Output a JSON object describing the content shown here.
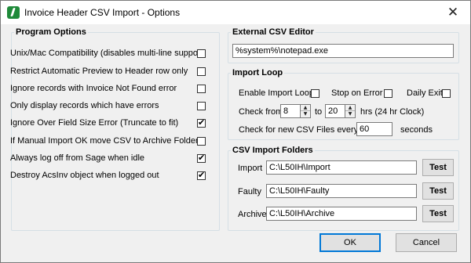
{
  "window": {
    "title": "Invoice Header CSV Import - Options",
    "close_symbol": "✕"
  },
  "program_options": {
    "legend": "Program Options",
    "items": [
      {
        "label": "Unix/Mac Compatibility (disables multi-line support)",
        "checked": false
      },
      {
        "label": "Restrict Automatic Preview to Header row only",
        "checked": false
      },
      {
        "label": "Ignore records with Invoice Not Found error",
        "checked": false
      },
      {
        "label": "Only display records which have errors",
        "checked": false
      },
      {
        "label": "Ignore Over Field Size Error (Truncate to fit)",
        "checked": true
      },
      {
        "label": "If Manual Import OK move CSV to Archive Folder",
        "checked": false
      },
      {
        "label": "Always log off from Sage when idle",
        "checked": true
      },
      {
        "label": "Destroy AcsInv object when logged out",
        "checked": true
      }
    ]
  },
  "external_editor": {
    "legend": "External CSV Editor",
    "value": "%system%\\notepad.exe"
  },
  "import_loop": {
    "legend": "Import Loop",
    "enable_label": "Enable Import Loop",
    "enable_checked": false,
    "stop_label": "Stop on Error",
    "stop_checked": false,
    "daily_label": "Daily Exit",
    "daily_checked": false,
    "check_from_label": "Check from",
    "from_value": "8",
    "to_label": "to",
    "to_value": "20",
    "hrs_label": "hrs  (24 hr Clock)",
    "check_every_label": "Check for new CSV Files every",
    "every_value": "60",
    "seconds_label": "seconds"
  },
  "folders": {
    "legend": "CSV Import Folders",
    "rows": [
      {
        "label": "Import",
        "value": "C:\\L50IH\\Import",
        "button": "Test"
      },
      {
        "label": "Faulty",
        "value": "C:\\L50IH\\Faulty",
        "button": "Test"
      },
      {
        "label": "Archive",
        "value": "C:\\L50IH\\Archive",
        "button": "Test"
      }
    ]
  },
  "buttons": {
    "ok": "OK",
    "cancel": "Cancel"
  }
}
